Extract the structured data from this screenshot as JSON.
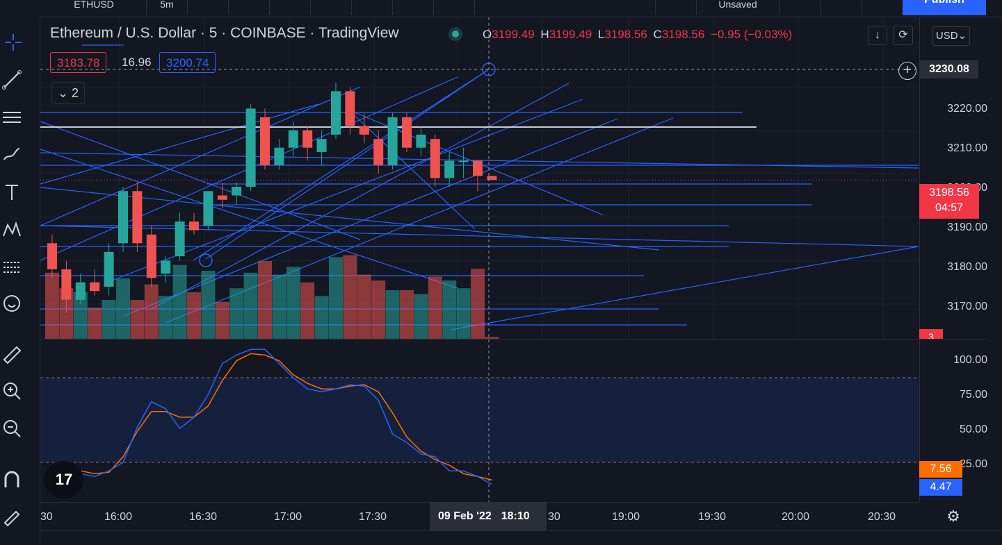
{
  "topbar": {
    "symbol": "ETHUSD",
    "interval": "5m",
    "publish_label": "Publish",
    "layout_name": "Unsaved"
  },
  "legend": {
    "title": "Ethereum / U.S. Dollar · 5 · COINBASE · TradingView",
    "o_label": "O",
    "o_value": "3199.49",
    "h_label": "H",
    "h_value": "3199.49",
    "l_label": "L",
    "l_value": "3198.56",
    "c_label": "C",
    "c_value": "3198.56",
    "change": "−0.95 (−0.03%)",
    "bid": "3183.78",
    "spread": "16.96",
    "ask": "3200.74",
    "collapse_count": "2"
  },
  "price_axis": {
    "currency": "USD",
    "labels": [
      "3220.00",
      "3210.00",
      "3200.00",
      "3190.00",
      "3180.00",
      "3170.00"
    ],
    "crosshair_price": "3230.08",
    "last_price": "3198.56",
    "countdown": "04:57",
    "volume_tag": "3"
  },
  "osc_axis": {
    "labels": [
      "100.00",
      "75.00",
      "50.00",
      "25.00"
    ],
    "k_value": "7.56",
    "d_value": "4.47"
  },
  "time_axis": {
    "labels": [
      "30",
      "16:00",
      "16:30",
      "17:00",
      "17:30",
      "30",
      "19:00",
      "19:30",
      "20:00",
      "20:30"
    ],
    "crosshair_date": "09 Feb '22",
    "crosshair_time": "18:10"
  },
  "colors": {
    "up": "#26a69a",
    "down": "#ef5350",
    "drawing": "#2962ff",
    "stoch_k": "#2962ff",
    "stoch_d": "#ff6d00",
    "background": "#131722"
  },
  "chart_data": {
    "type": "candlestick",
    "candles": [
      {
        "o": 3184.0,
        "h": 3186.0,
        "l": 3176.0,
        "c": 3178.0
      },
      {
        "o": 3178.0,
        "h": 3180.0,
        "l": 3168.0,
        "c": 3171.0
      },
      {
        "o": 3171.0,
        "h": 3177.0,
        "l": 3170.0,
        "c": 3175.0
      },
      {
        "o": 3175.0,
        "h": 3178.0,
        "l": 3172.0,
        "c": 3173.0
      },
      {
        "o": 3174.0,
        "h": 3184.0,
        "l": 3172.0,
        "c": 3182.0
      },
      {
        "o": 3184.0,
        "h": 3197.0,
        "l": 3182.0,
        "c": 3196.0
      },
      {
        "o": 3196.0,
        "h": 3198.0,
        "l": 3182.0,
        "c": 3184.0
      },
      {
        "o": 3186.0,
        "h": 3188.0,
        "l": 3174.0,
        "c": 3176.0
      },
      {
        "o": 3177.0,
        "h": 3181.0,
        "l": 3175.0,
        "c": 3180.0
      },
      {
        "o": 3181.0,
        "h": 3191.0,
        "l": 3180.0,
        "c": 3189.0
      },
      {
        "o": 3189.0,
        "h": 3191.0,
        "l": 3186.0,
        "c": 3187.0
      },
      {
        "o": 3188.0,
        "h": 3196.0,
        "l": 3187.0,
        "c": 3196.0
      },
      {
        "o": 3195.0,
        "h": 3198.0,
        "l": 3192.0,
        "c": 3194.0
      },
      {
        "o": 3195.0,
        "h": 3198.0,
        "l": 3193.0,
        "c": 3197.0
      },
      {
        "o": 3197.0,
        "h": 3216.0,
        "l": 3196.0,
        "c": 3215.0
      },
      {
        "o": 3213.0,
        "h": 3215.0,
        "l": 3201.0,
        "c": 3202.0
      },
      {
        "o": 3202.0,
        "h": 3208.0,
        "l": 3201.0,
        "c": 3206.0
      },
      {
        "o": 3206.0,
        "h": 3212.0,
        "l": 3204.0,
        "c": 3210.0
      },
      {
        "o": 3210.0,
        "h": 3211.0,
        "l": 3203.0,
        "c": 3206.0
      },
      {
        "o": 3205.0,
        "h": 3210.0,
        "l": 3202.0,
        "c": 3208.0
      },
      {
        "o": 3209.0,
        "h": 3221.0,
        "l": 3208.0,
        "c": 3219.0
      },
      {
        "o": 3219.0,
        "h": 3220.0,
        "l": 3209.0,
        "c": 3211.0
      },
      {
        "o": 3211.0,
        "h": 3214.0,
        "l": 3207.0,
        "c": 3209.0
      },
      {
        "o": 3208.0,
        "h": 3210.0,
        "l": 3200.0,
        "c": 3202.0
      },
      {
        "o": 3202.0,
        "h": 3214.0,
        "l": 3201.0,
        "c": 3213.0
      },
      {
        "o": 3213.0,
        "h": 3214.0,
        "l": 3205.0,
        "c": 3206.0
      },
      {
        "o": 3206.0,
        "h": 3211.0,
        "l": 3204.0,
        "c": 3209.0
      },
      {
        "o": 3208.0,
        "h": 3209.0,
        "l": 3197.0,
        "c": 3199.0
      },
      {
        "o": 3199.0,
        "h": 3205.0,
        "l": 3197.0,
        "c": 3203.0
      },
      {
        "o": 3203.0,
        "h": 3206.0,
        "l": 3199.0,
        "c": 3203.0
      },
      {
        "o": 3203.0,
        "h": 3203.0,
        "l": 3196.0,
        "c": 3199.5
      },
      {
        "o": 3199.49,
        "h": 3199.49,
        "l": 3198.56,
        "c": 3198.56
      }
    ],
    "volumes": [
      68,
      52,
      48,
      32,
      40,
      62,
      40,
      56,
      44,
      76,
      48,
      70,
      38,
      52,
      68,
      80,
      66,
      74,
      58,
      44,
      84,
      86,
      66,
      60,
      50,
      50,
      46,
      64,
      60,
      52,
      72,
      2
    ],
    "stoch_k": [
      16,
      18,
      12,
      10,
      14,
      20,
      45,
      63,
      58,
      44,
      52,
      68,
      90,
      96,
      100,
      100,
      90,
      80,
      72,
      70,
      72,
      75,
      74,
      64,
      40,
      34,
      26,
      24,
      14,
      14,
      10,
      4.47
    ],
    "stoch_d": [
      14,
      15,
      14,
      12,
      13,
      24,
      42,
      56,
      56,
      52,
      52,
      60,
      78,
      92,
      97,
      96,
      92,
      82,
      76,
      72,
      72,
      74,
      75,
      70,
      55,
      38,
      28,
      22,
      18,
      12,
      10,
      7.56
    ],
    "price_range": [
      3162,
      3236
    ],
    "osc_range": [
      -8,
      107
    ]
  }
}
